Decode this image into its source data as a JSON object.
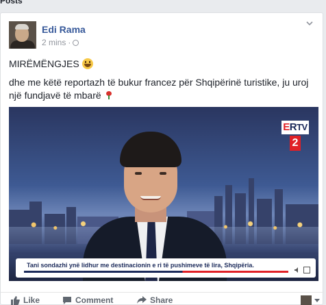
{
  "section": {
    "title": "Posts"
  },
  "post": {
    "author": "Edi Rama",
    "timestamp": "2 mins",
    "privacy_icon": "globe-icon",
    "text_line1": "MIRËMËNGJES",
    "text_line2": "dhe me këtë reportazh të bukur francez për Shqipërinë turistike, ju uroj një fundjavë të mbarë"
  },
  "video": {
    "channel_logo_e": "E",
    "channel_logo_r": "R",
    "channel_logo_tv": "TV",
    "channel_number": "2",
    "caption": "Tani sondazhi ynë lidhur me destinacionin e ri të pushimeve të lira, Shqipëria."
  },
  "actions": {
    "like": "Like",
    "comment": "Comment",
    "share": "Share"
  },
  "colors": {
    "author_link": "#365899",
    "action_text": "#606770",
    "channel_red": "#e02026",
    "channel_navy": "#1b2a5a"
  }
}
